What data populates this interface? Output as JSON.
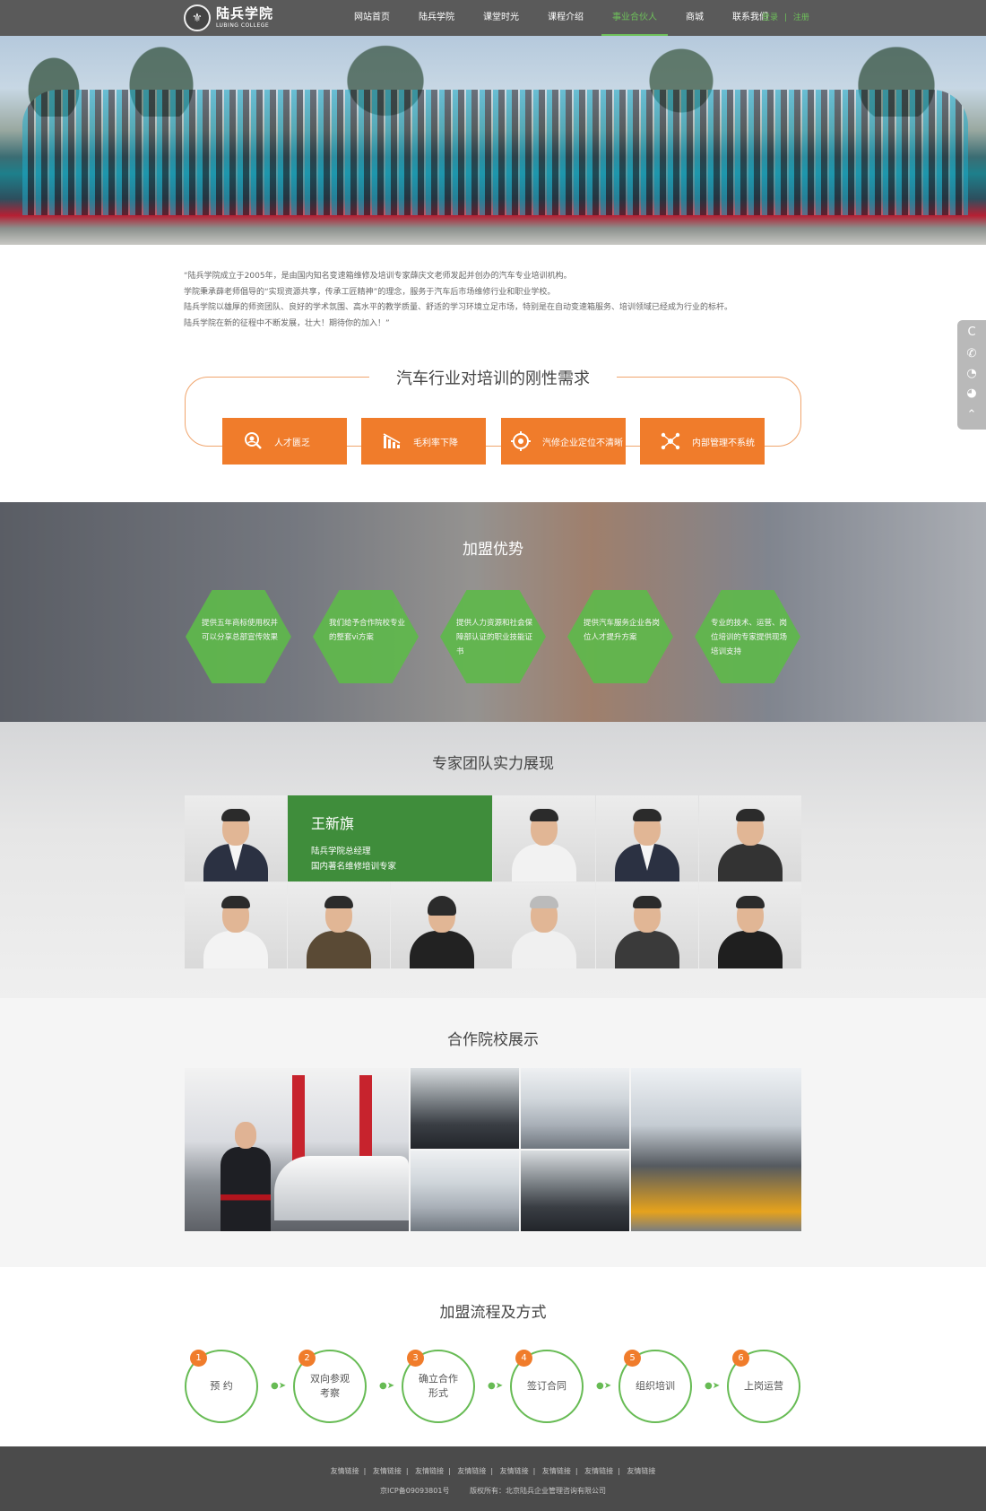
{
  "header": {
    "logo_cn": "陆兵学院",
    "logo_en": "LUBING COLLEGE",
    "nav": [
      "网站首页",
      "陆兵学院",
      "课堂时光",
      "课程介绍",
      "事业合伙人",
      "商城",
      "联系我们"
    ],
    "active_index": 4,
    "login": "登录",
    "sep": "|",
    "register": "注册"
  },
  "intro": {
    "lines": [
      "“陆兵学院成立于2005年，是由国内知名变速箱维修及培训专家薛庆文老师发起并创办的汽车专业培训机构。",
      "学院秉承薛老师倡导的“实现资源共享，传承工匠精神”的理念，服务于汽车后市场维修行业和职业学校。",
      "陆兵学院以雄厚的师资团队、良好的学术氛围、高水平的教学质量、舒适的学习环境立足市场，特别是在自动变速箱服务、培训领域已经成为行业的标杆。",
      "陆兵学院在新的征程中不断发展，壮大！期待你的加入！”"
    ]
  },
  "needs": {
    "title": "汽车行业对培训的刚性需求",
    "items": [
      "人才匮乏",
      "毛利率下降",
      "汽修企业定位不清晰",
      "内部管理不系统"
    ]
  },
  "advantages": {
    "title": "加盟优势",
    "items": [
      "提供五年商标使用权并可以分享总部宣传效果",
      "我们给予合作院校专业的整套vi方案",
      "提供人力资源和社会保障部认证的职业技能证书",
      "提供汽车服务企业各岗位人才提升方案",
      "专业的技术、运营、岗位培训的专家提供现场培训支持"
    ]
  },
  "experts": {
    "title": "专家团队实力展现",
    "featured": {
      "name": "王新旗",
      "title": "陆兵学院总经理",
      "desc": "国内著名维修培训专家"
    }
  },
  "partners": {
    "title": "合作院校展示"
  },
  "process": {
    "title": "加盟流程及方式",
    "steps": [
      {
        "num": "1",
        "label": "预 约"
      },
      {
        "num": "2",
        "label": "双向参观考察"
      },
      {
        "num": "3",
        "label": "确立合作形式"
      },
      {
        "num": "4",
        "label": "签订合同"
      },
      {
        "num": "5",
        "label": "组织培训"
      },
      {
        "num": "6",
        "label": "上岗运营"
      }
    ]
  },
  "footer": {
    "links": [
      "友情链接",
      "友情链接",
      "友情链接",
      "友情链接",
      "友情链接",
      "友情链接",
      "友情链接",
      "友情链接"
    ],
    "icp": "京ICP备09093801号",
    "copyright": "版权所有：北京陆兵企业管理咨询有限公司"
  },
  "colors": {
    "accent_green": "#5fb94b",
    "accent_orange": "#f07c2b",
    "header_bg": "#5a5a5a"
  }
}
